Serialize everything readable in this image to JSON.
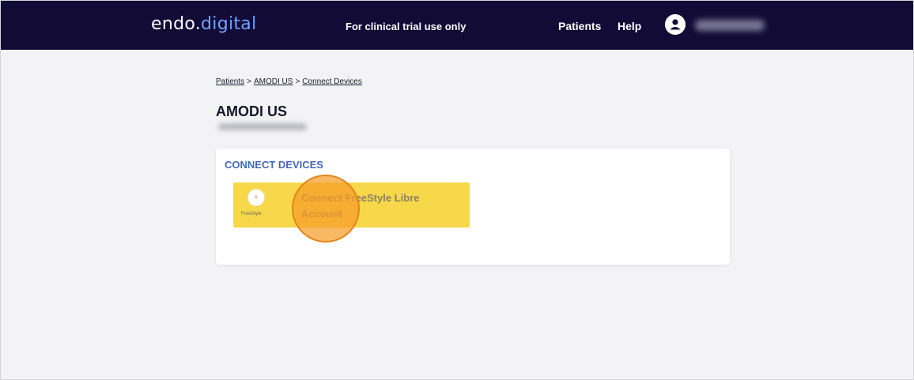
{
  "header": {
    "logo_main": "endo.",
    "logo_accent": "digital",
    "trial_note": "For clinical trial use only",
    "nav": {
      "patients": "Patients",
      "help": "Help"
    }
  },
  "breadcrumb": {
    "items": [
      "Patients",
      "AMODI US",
      "Connect Devices"
    ],
    "separator": ">"
  },
  "patient": {
    "name": "AMODI US"
  },
  "connect_devices": {
    "title": "CONNECT DEVICES",
    "button_label": "Connect FreeStyle Libre Account",
    "brand_label": "FreeStyle"
  },
  "colors": {
    "header_bg": "#110b36",
    "accent": "#6fa3ff",
    "card_title": "#4367b8",
    "device_button": "#f6d84a",
    "click_marker": "#f79c28"
  }
}
